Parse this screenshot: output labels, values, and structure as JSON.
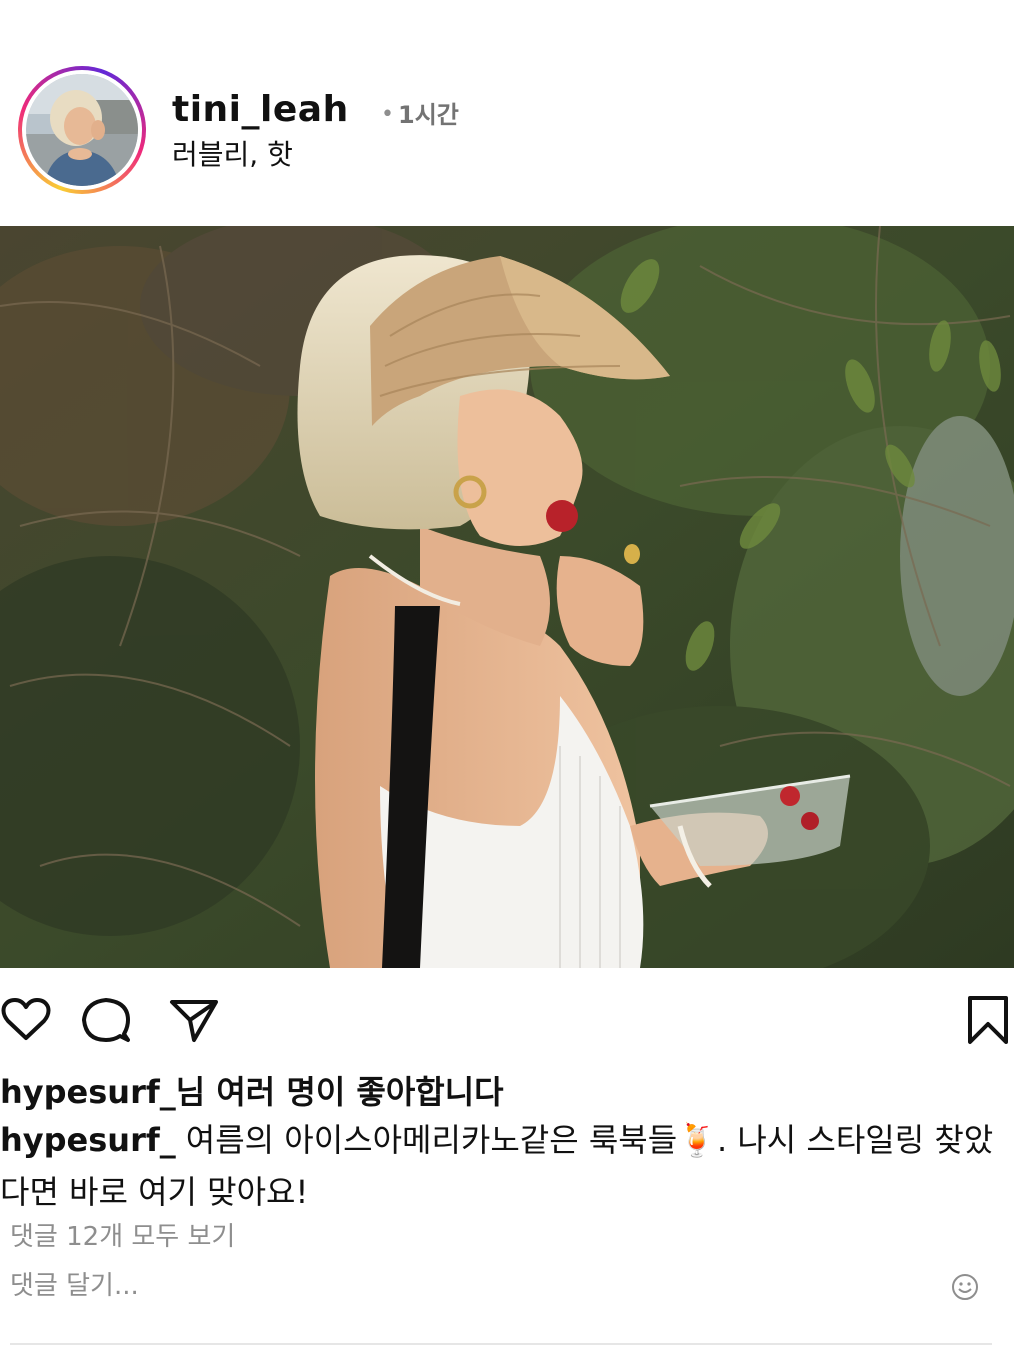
{
  "post": {
    "username": "tini_leah",
    "time_separator": "•",
    "time": "1시간",
    "location": "러블리, 핫",
    "photo_icon": "post-photo"
  },
  "actions": {
    "like_icon": "heart-icon",
    "comment_icon": "comment-icon",
    "share_icon": "share-icon",
    "save_icon": "bookmark-icon"
  },
  "likes": {
    "user": "hypesurf_",
    "text": "님 여러 명이 좋아합니다"
  },
  "caption": {
    "user": "hypesurf_",
    "text_before_emoji": "여름의 아이스아메리카노같은 룩북들",
    "emoji": "🍹",
    "text_after_emoji": ". 나시 스타일링 찾았다면 바로 여기 맞아요!"
  },
  "comments": {
    "view_all": "댓글 12개 모두 보기",
    "input_placeholder": "댓글 달기...",
    "emoji_icon": "smiley-icon"
  },
  "colors": {
    "text": "#111111",
    "secondary": "#8e8e8e",
    "divider": "#e6e6e6"
  }
}
